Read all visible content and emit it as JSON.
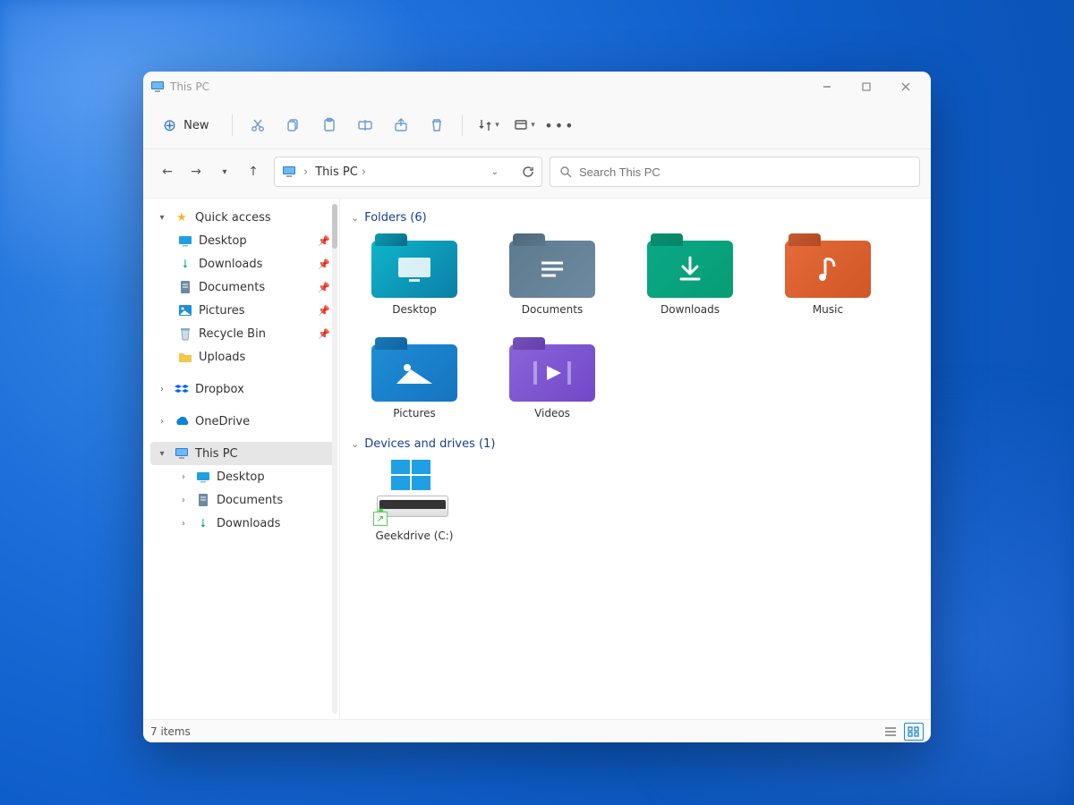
{
  "window": {
    "title": "This PC"
  },
  "toolbar": {
    "new_label": "New"
  },
  "address": {
    "location": "This PC",
    "separator": "›"
  },
  "search": {
    "placeholder": "Search This PC"
  },
  "sidebar": {
    "quick_access": {
      "label": "Quick access",
      "items": [
        {
          "label": "Desktop",
          "icon": "desktop",
          "pinned": true
        },
        {
          "label": "Downloads",
          "icon": "downloads",
          "pinned": true
        },
        {
          "label": "Documents",
          "icon": "documents",
          "pinned": true
        },
        {
          "label": "Pictures",
          "icon": "pictures",
          "pinned": true
        },
        {
          "label": "Recycle Bin",
          "icon": "recycle",
          "pinned": true
        },
        {
          "label": "Uploads",
          "icon": "folder",
          "pinned": false
        }
      ]
    },
    "dropbox": {
      "label": "Dropbox"
    },
    "onedrive": {
      "label": "OneDrive"
    },
    "this_pc": {
      "label": "This PC",
      "items": [
        {
          "label": "Desktop",
          "icon": "desktop"
        },
        {
          "label": "Documents",
          "icon": "documents"
        },
        {
          "label": "Downloads",
          "icon": "downloads"
        }
      ]
    }
  },
  "sections": {
    "folders": {
      "heading": "Folders (6)",
      "items": [
        {
          "label": "Desktop",
          "kind": "desktop"
        },
        {
          "label": "Documents",
          "kind": "documents"
        },
        {
          "label": "Downloads",
          "kind": "downloads"
        },
        {
          "label": "Music",
          "kind": "music"
        },
        {
          "label": "Pictures",
          "kind": "pictures"
        },
        {
          "label": "Videos",
          "kind": "videos"
        }
      ]
    },
    "drives": {
      "heading": "Devices and drives (1)",
      "items": [
        {
          "label": "Geekdrive (C:)"
        }
      ]
    }
  },
  "status": {
    "text": "7 items"
  }
}
